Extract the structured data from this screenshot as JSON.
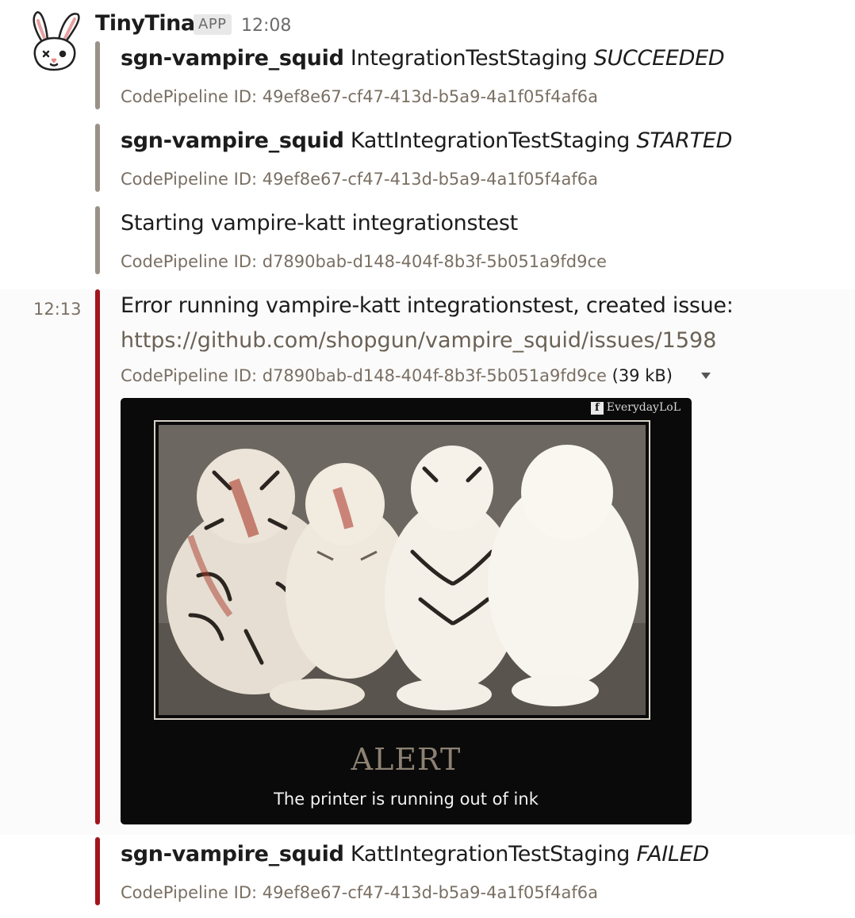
{
  "message": {
    "author": "TinyTina",
    "badge": "APP",
    "time": "12:08"
  },
  "attachments": [
    {
      "project": "sgn-vampire_squid",
      "stage": "IntegrationTestStaging",
      "status": "SUCCEEDED",
      "footer": "CodePipeline ID: 49ef8e67-cf47-413d-b5a9-4a1f05f4af6a",
      "color": "#9a9187"
    },
    {
      "project": "sgn-vampire_squid",
      "stage": "KattIntegrationTestStaging",
      "status": "STARTED",
      "footer": "CodePipeline ID: 49ef8e67-cf47-413d-b5a9-4a1f05f4af6a",
      "color": "#9a9187"
    },
    {
      "text": "Starting vampire-katt integrationstest",
      "footer": "CodePipeline ID: d7890bab-d148-404f-8b3f-5b051a9fd9ce",
      "color": "#9a9187"
    },
    {
      "time": "12:13",
      "text": "Error running vampire-katt integrationstest, created issue:",
      "link": "https://github.com/shopgun/vampire_squid/issues/1598",
      "footer": "CodePipeline ID: d7890bab-d148-404f-8b3f-5b051a9fd9ce",
      "file_size": "(39 kB)",
      "color": "#a3141c",
      "image": {
        "watermark": "EverydayLoL",
        "title": "ALERT",
        "caption": "The printer is running out of ink"
      }
    },
    {
      "project": "sgn-vampire_squid",
      "stage": "KattIntegrationTestStaging",
      "status": "FAILED",
      "footer": "CodePipeline ID: 49ef8e67-cf47-413d-b5a9-4a1f05f4af6a",
      "color": "#a3141c"
    }
  ]
}
